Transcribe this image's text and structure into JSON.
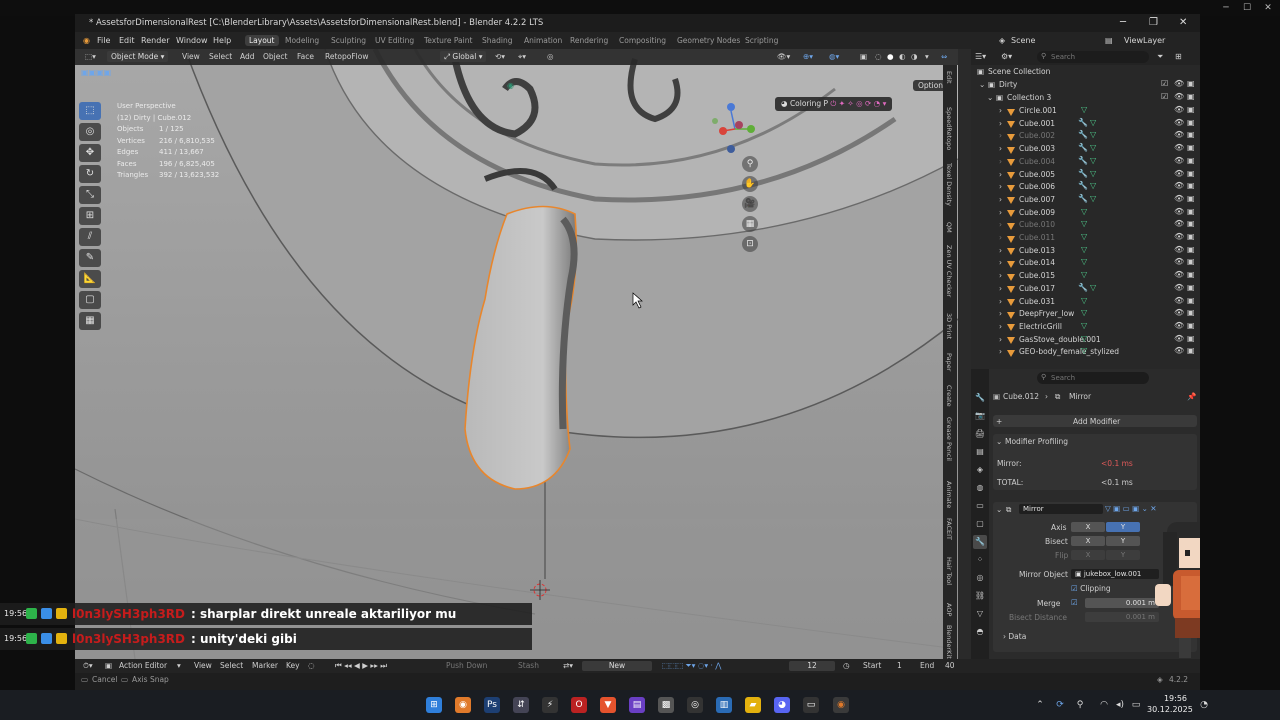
{
  "blender": {
    "title": "* AssetsforDimensionalRest [C:\\BlenderLibrary\\Assets\\AssetsforDimensionalRest.blend] - Blender 4.2.2 LTS",
    "menu": [
      "File",
      "Edit",
      "Render",
      "Window",
      "Help"
    ],
    "workspaces": [
      {
        "label": "Layout",
        "active": true
      },
      {
        "label": "Modeling"
      },
      {
        "label": "Sculpting"
      },
      {
        "label": "UV Editing"
      },
      {
        "label": "Texture Paint"
      },
      {
        "label": "Shading"
      },
      {
        "label": "Animation"
      },
      {
        "label": "Rendering"
      },
      {
        "label": "Compositing"
      },
      {
        "label": "Geometry Nodes"
      },
      {
        "label": "Scripting"
      }
    ],
    "scene_name": "Scene",
    "view_layer": "ViewLayer"
  },
  "viewport": {
    "mode": "Object Mode",
    "menu": [
      "View",
      "Select",
      "Add",
      "Object",
      "Face",
      "RetopoFlow"
    ],
    "orientation": "Global",
    "options_label": "Options",
    "coloring_label": "Coloring P",
    "stats": {
      "title": "User Perspective",
      "subtitle": "(12) Dirty | Cube.012",
      "rows": [
        {
          "k": "Objects",
          "v": "1 / 125"
        },
        {
          "k": "Vertices",
          "v": "216 / 6,810,535"
        },
        {
          "k": "Edges",
          "v": "411 / 13,667"
        },
        {
          "k": "Faces",
          "v": "196 / 6,825,405"
        },
        {
          "k": "Triangles",
          "v": "392 / 13,623,532"
        }
      ]
    },
    "side_tabs": [
      "Edit",
      "SpeedRetopo",
      "Texel Density",
      "QM",
      "Zen UV Checker",
      "3D Print",
      "Paper",
      "Create",
      "Grease Pencil",
      "Animate",
      "FACEIT",
      "Hair Tool",
      "AOP",
      "BlenderKit"
    ]
  },
  "outliner": {
    "search_placeholder": "Search",
    "root": "Scene Collection",
    "collection": "Dirty",
    "subcollection": "Collection 3",
    "items": [
      {
        "name": "Circle.001",
        "dim": false
      },
      {
        "name": "Cube.001",
        "dim": false
      },
      {
        "name": "Cube.002",
        "dim": true
      },
      {
        "name": "Cube.003",
        "dim": false
      },
      {
        "name": "Cube.004",
        "dim": true
      },
      {
        "name": "Cube.005",
        "dim": false
      },
      {
        "name": "Cube.006",
        "dim": false
      },
      {
        "name": "Cube.007",
        "dim": false
      },
      {
        "name": "Cube.009",
        "dim": false
      },
      {
        "name": "Cube.010",
        "dim": true
      },
      {
        "name": "Cube.011",
        "dim": true
      },
      {
        "name": "Cube.013",
        "dim": false
      },
      {
        "name": "Cube.014",
        "dim": false
      },
      {
        "name": "Cube.015",
        "dim": false
      },
      {
        "name": "Cube.017",
        "dim": false
      },
      {
        "name": "Cube.031",
        "dim": false
      },
      {
        "name": "DeepFryer_low",
        "dim": false
      },
      {
        "name": "ElectricGrill",
        "dim": false
      },
      {
        "name": "GasStove_double.001",
        "dim": false
      },
      {
        "name": "GEO-body_female_stylized",
        "dim": false
      }
    ]
  },
  "properties": {
    "search_placeholder": "Search",
    "breadcrumb_object": "Cube.012",
    "breadcrumb_modifier": "Mirror",
    "add_modifier": "Add Modifier",
    "profiling_title": "Modifier Profiling",
    "profiling_mirror_label": "Mirror:",
    "profiling_mirror_value": "<0.1 ms",
    "profiling_total_label": "TOTAL:",
    "profiling_total_value": "<0.1 ms",
    "modifier_name": "Mirror",
    "axis_label": "Axis",
    "bisect_label": "Bisect",
    "flip_label": "Flip",
    "x": "X",
    "y": "Y",
    "mirror_object_label": "Mirror Object",
    "mirror_object_value": "jukebox_low.001",
    "clipping_label": "Clipping",
    "merge_label": "Merge",
    "merge_value": "0.001 m",
    "bisect_distance_label": "Bisect Distance",
    "bisect_distance_value": "0.001 m",
    "data_label": "Data"
  },
  "timeline": {
    "editor": "Action Editor",
    "menu": [
      "View",
      "Select",
      "Marker",
      "Key"
    ],
    "push_down": "Push Down",
    "stash": "Stash",
    "new": "New",
    "current_frame": "12",
    "start_label": "Start",
    "start_value": "1",
    "end_label": "End",
    "end_value": "40"
  },
  "status": {
    "cancel": "Cancel",
    "axis_snap": "Axis Snap",
    "version": "4.2.2"
  },
  "chat": [
    {
      "time": "19:56",
      "user": "l0n3lySH3ph3RD",
      "message": ": sharplar direkt unreale aktariliyor mu"
    },
    {
      "time": "19:56",
      "user": "l0n3lySH3ph3RD",
      "message": ": unity'deki gibi"
    }
  ],
  "taskbar": {
    "time": "19:56",
    "date": "30.12.2025"
  }
}
